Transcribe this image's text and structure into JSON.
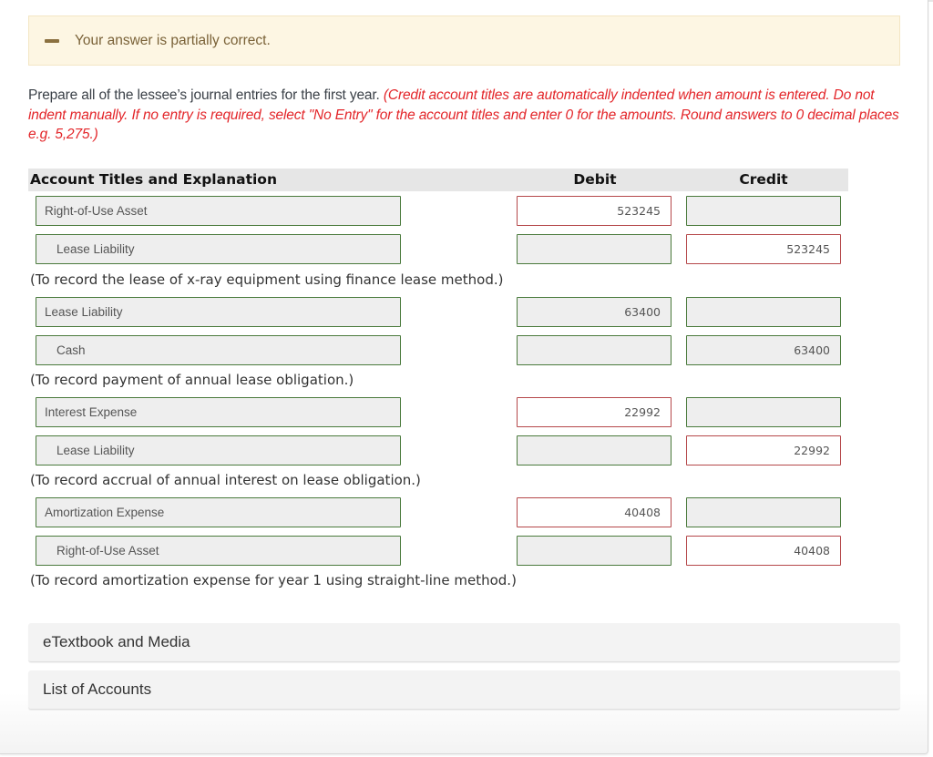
{
  "feedback": {
    "icon": "minus-icon",
    "message": "Your answer is partially correct."
  },
  "prompt": {
    "text": "Prepare all of the lessee’s journal entries for the first year.",
    "instruction": "(Credit account titles are automatically indented when amount is entered. Do not indent manually. If no entry is required, select \"No Entry\" for the account titles and enter 0 for the amounts. Round answers to 0 decimal places e.g. 5,275.)"
  },
  "table": {
    "headers": {
      "account": "Account Titles and Explanation",
      "debit": "Debit",
      "credit": "Credit"
    },
    "entries": [
      {
        "lines": [
          {
            "account": "Right-of-Use Asset",
            "debit": "523245",
            "credit": "",
            "debit_status": "incorrect",
            "credit_status": "correct"
          },
          {
            "account": "Lease Liability",
            "debit": "",
            "credit": "523245",
            "debit_status": "correct",
            "credit_status": "incorrect"
          }
        ],
        "explanation": "(To record the lease of x-ray equipment using finance lease method.)"
      },
      {
        "lines": [
          {
            "account": "Lease Liability",
            "debit": "63400",
            "credit": "",
            "debit_status": "correct",
            "credit_status": "correct"
          },
          {
            "account": "Cash",
            "debit": "",
            "credit": "63400",
            "debit_status": "correct",
            "credit_status": "correct"
          }
        ],
        "explanation": "(To record payment of annual lease obligation.)"
      },
      {
        "lines": [
          {
            "account": "Interest Expense",
            "debit": "22992",
            "credit": "",
            "debit_status": "incorrect",
            "credit_status": "correct"
          },
          {
            "account": "Lease Liability",
            "debit": "",
            "credit": "22992",
            "debit_status": "correct",
            "credit_status": "incorrect"
          }
        ],
        "explanation": "(To record accrual of annual interest on lease obligation.)"
      },
      {
        "lines": [
          {
            "account": "Amortization Expense",
            "debit": "40408",
            "credit": "",
            "debit_status": "incorrect",
            "credit_status": "correct"
          },
          {
            "account": "Right-of-Use Asset",
            "debit": "",
            "credit": "40408",
            "debit_status": "correct",
            "credit_status": "incorrect"
          }
        ],
        "explanation": "(To record amortization expense for year 1 using straight-line method.)"
      }
    ]
  },
  "links": {
    "etextbook": "eTextbook and Media",
    "list_of_accounts": "List of Accounts"
  },
  "colors": {
    "correct_border": "#4a7a3c",
    "incorrect_border": "#b5484a",
    "instruction_red": "#e3262a",
    "feedback_bg": "#fdf6e3"
  }
}
